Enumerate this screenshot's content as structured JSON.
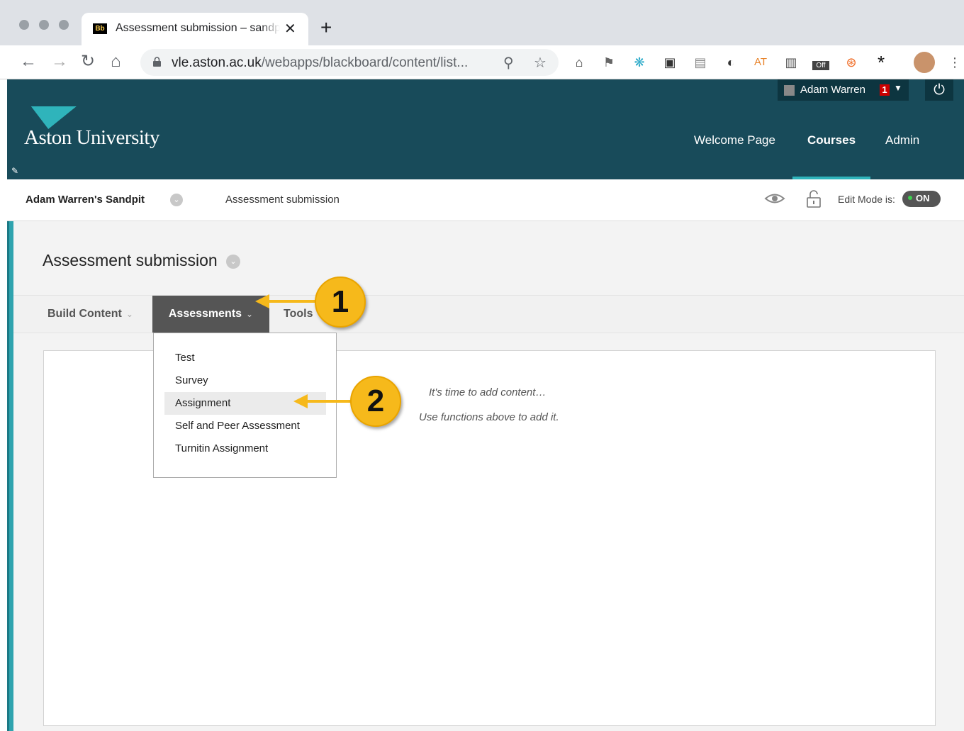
{
  "browser": {
    "tab_title": "Assessment submission – sandpit",
    "tab_favicon": "Bb",
    "url_host": "vle.aston.ac.uk",
    "url_path": "/webapps/blackboard/content/list...",
    "ext_at": "AT",
    "ext_off": "Off"
  },
  "header": {
    "logo_text": "Aston University",
    "user_name": "Adam Warren",
    "notification_count": "1",
    "nav": {
      "welcome": "Welcome Page",
      "courses": "Courses",
      "admin": "Admin"
    }
  },
  "breadcrumb": {
    "course": "Adam Warren's Sandpit",
    "page": "Assessment submission",
    "edit_mode_label": "Edit Mode is:",
    "edit_mode_state": "ON"
  },
  "content": {
    "page_title": "Assessment submission",
    "actions": {
      "build": "Build Content",
      "assessments": "Assessments",
      "tools": "Tools"
    },
    "empty_line1": "It's time to add content…",
    "empty_line2": "Use functions above to add it."
  },
  "dropdown": {
    "items": [
      "Test",
      "Survey",
      "Assignment",
      "Self and Peer Assessment",
      "Turnitin Assignment"
    ],
    "highlighted": "Assignment"
  },
  "callouts": {
    "step1": "1",
    "step2": "2"
  },
  "colors": {
    "header_bg": "#184b5a",
    "accent": "#2fb4bb",
    "callout": "#f6b91b"
  }
}
